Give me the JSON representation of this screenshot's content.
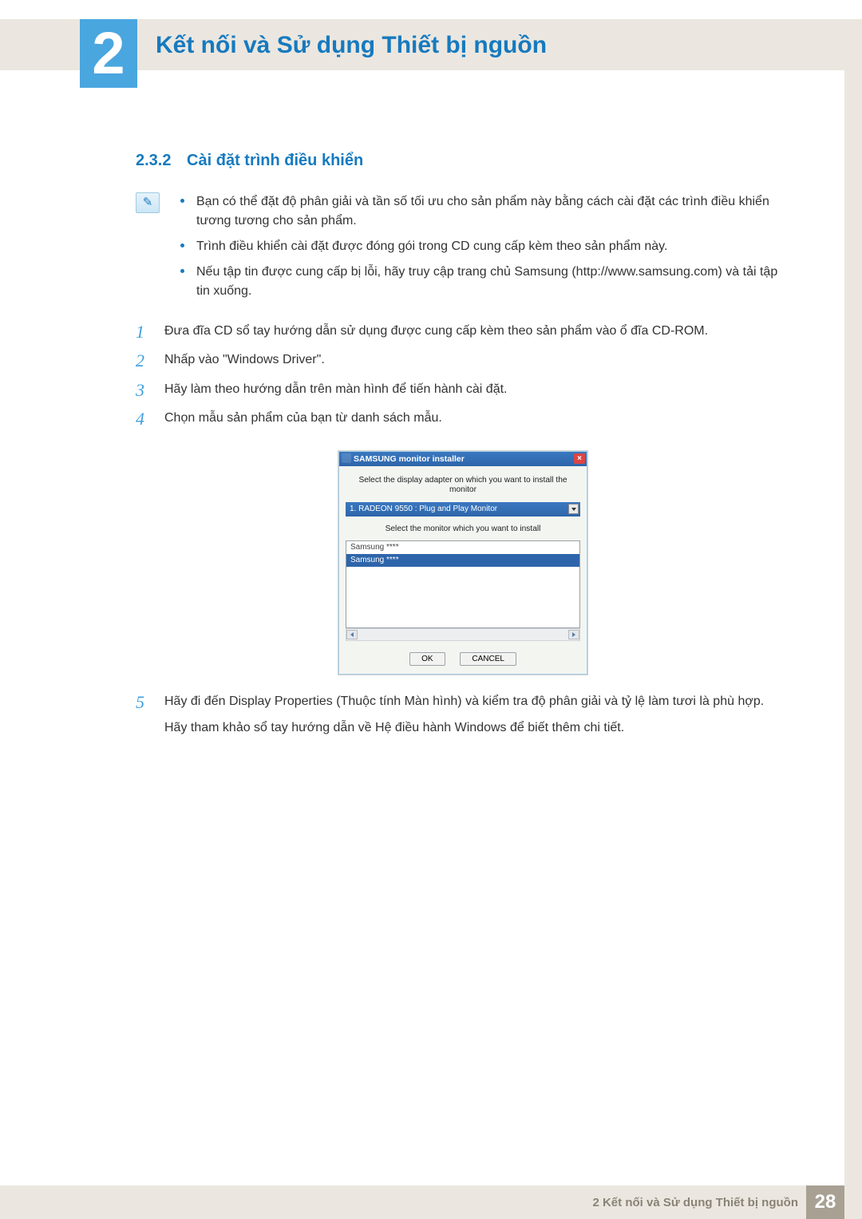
{
  "chapter_number": "2",
  "page_title": "Kết nối và Sử dụng Thiết bị nguồn",
  "section": {
    "number": "2.3.2",
    "title": "Cài đặt trình điều khiển"
  },
  "notes": [
    "Bạn có thể đặt độ phân giải và tần số tối ưu cho sản phẩm này bằng cách cài đặt các trình điều khiển tương tương cho sản phẩm.",
    "Trình điều khiển cài đặt được đóng gói trong CD cung cấp kèm theo sản phẩm này.",
    "Nếu tập tin được cung cấp bị lỗi, hãy truy cập trang chủ Samsung (http://www.samsung.com) và tải tập tin xuống."
  ],
  "steps": [
    {
      "n": "1",
      "text": "Đưa đĩa CD sổ tay hướng dẫn sử dụng được cung cấp kèm theo sản phẩm vào ổ đĩa CD-ROM."
    },
    {
      "n": "2",
      "text": "Nhấp vào \"Windows Driver\"."
    },
    {
      "n": "3",
      "text": "Hãy làm theo hướng dẫn trên màn hình để tiến hành cài đặt."
    },
    {
      "n": "4",
      "text": "Chọn mẫu sản phẩm của bạn từ danh sách mẫu."
    },
    {
      "n": "5",
      "text": "Hãy đi đến Display Properties (Thuộc tính Màn hình) và kiểm tra độ phân giải và tỷ lệ làm tươi là phù hợp.",
      "sub": "Hãy tham khảo sổ tay hướng dẫn về Hệ điều hành Windows để biết thêm chi tiết."
    }
  ],
  "dialog": {
    "title": "SAMSUNG monitor installer",
    "line1": "Select the display adapter on which you want to install the monitor",
    "select_value": "1. RADEON 9550 : Plug and Play Monitor",
    "line2": "Select the monitor which you want to install",
    "list": [
      "Samsung ****",
      "Samsung ****"
    ],
    "ok": "OK",
    "cancel": "CANCEL"
  },
  "footer": {
    "text": "2 Kết nối và Sử dụng Thiết bị nguồn",
    "page": "28"
  }
}
